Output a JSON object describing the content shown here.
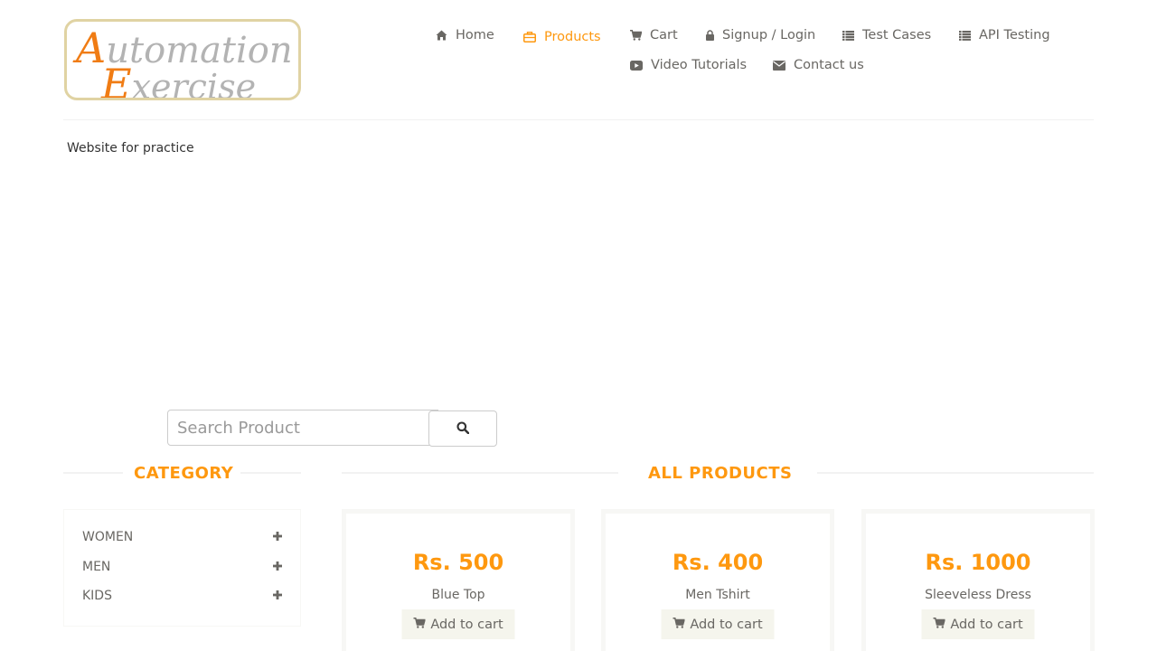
{
  "logo": {
    "line1_initial": "A",
    "line1_rest": "utomation",
    "line2_initial": "E",
    "line2_rest": "xercise"
  },
  "nav": {
    "home": "Home",
    "products": "Products",
    "cart": "Cart",
    "login": "Signup / Login",
    "test_cases": "Test Cases",
    "api_testing": "API Testing",
    "video_tutorials": "Video Tutorials",
    "contact_us": "Contact us"
  },
  "tagline": "Website for practice",
  "search": {
    "placeholder": "Search Product",
    "value": ""
  },
  "category": {
    "title": "CATEGORY",
    "items": [
      {
        "label": "WOMEN"
      },
      {
        "label": "MEN"
      },
      {
        "label": "KIDS"
      }
    ]
  },
  "products": {
    "title": "ALL PRODUCTS",
    "items": [
      {
        "price": "Rs. 500",
        "name": "Blue Top",
        "button": "Add to cart"
      },
      {
        "price": "Rs. 400",
        "name": "Men Tshirt",
        "button": "Add to cart"
      },
      {
        "price": "Rs. 1000",
        "name": "Sleeveless Dress",
        "button": "Add to cart"
      }
    ]
  },
  "colors": {
    "accent": "#fe980f",
    "text": "#696763",
    "logo_orange": "#f07c14",
    "logo_border": "#e0d3a3"
  },
  "icons": [
    "home-icon",
    "products-icon",
    "cart-icon",
    "lock-icon",
    "list-icon",
    "video-icon",
    "envelope-icon",
    "search-icon",
    "plus-icon"
  ]
}
